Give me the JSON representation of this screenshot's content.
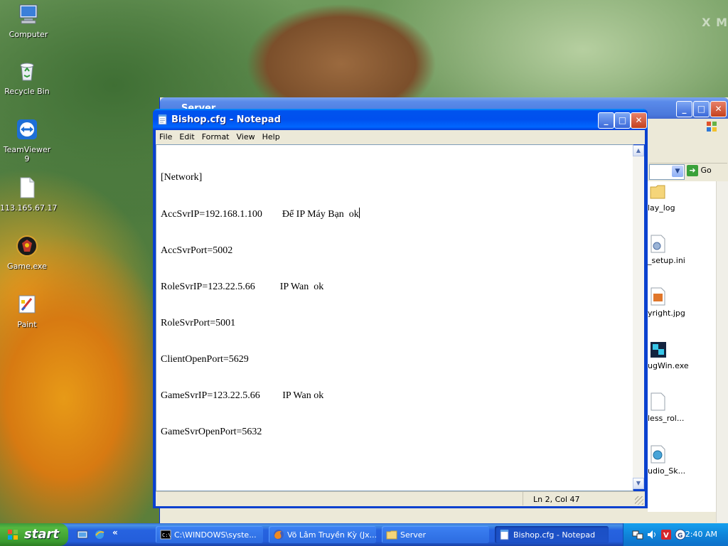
{
  "desktop": {
    "watermark": "X M",
    "icons": [
      {
        "label": "Computer",
        "icon": "computer-icon"
      },
      {
        "label": "Recycle Bin",
        "icon": "recycle-bin-icon"
      },
      {
        "label": "TeamViewer 9",
        "icon": "teamviewer-icon"
      },
      {
        "label": "113.165.67.17",
        "icon": "file-icon"
      },
      {
        "label": "Game.exe",
        "icon": "game-icon"
      },
      {
        "label": "Paint",
        "icon": "paint-icon"
      }
    ]
  },
  "explorer": {
    "title": "Server",
    "go_label": "Go",
    "items": [
      "lay_log",
      "_setup.ini",
      "yright.jpg",
      "ugWin.exe",
      "less_rol...",
      "udio_Sk..."
    ]
  },
  "notepad": {
    "title": "Bishop.cfg - Notepad",
    "menu": [
      "File",
      "Edit",
      "Format",
      "View",
      "Help"
    ],
    "lines": [
      "[Network]",
      "AccSvrIP=192.168.1.100        Để IP Máy Bạn  ok",
      "AccSvrPort=5002",
      "RoleSvrIP=123.22.5.66          IP Wan  ok",
      "RoleSvrPort=5001",
      "ClientOpenPort=5629",
      "GameSvrIP=123.22.5.66         IP Wan ok",
      "GameSvrOpenPort=5632"
    ],
    "status": "Ln 2, Col 47"
  },
  "taskbar": {
    "start_label": "start",
    "chevron": "«",
    "buttons": [
      {
        "label": "C:\\WINDOWS\\syste...",
        "icon": "cmd-icon",
        "active": false
      },
      {
        "label": "Võ Lâm Truyền Kỳ (Jx...",
        "icon": "firefox-icon",
        "active": false
      },
      {
        "label": "Server",
        "icon": "folder-icon",
        "active": false
      },
      {
        "label": "Bishop.cfg - Notepad",
        "icon": "notepad-icon",
        "active": true
      }
    ],
    "tray_chevron": "»",
    "clock": "2:40 AM"
  },
  "colors": {
    "titlebar": "#0053ee",
    "taskbar": "#245edb",
    "start": "#3a9a2f",
    "tray": "#0f85da"
  }
}
